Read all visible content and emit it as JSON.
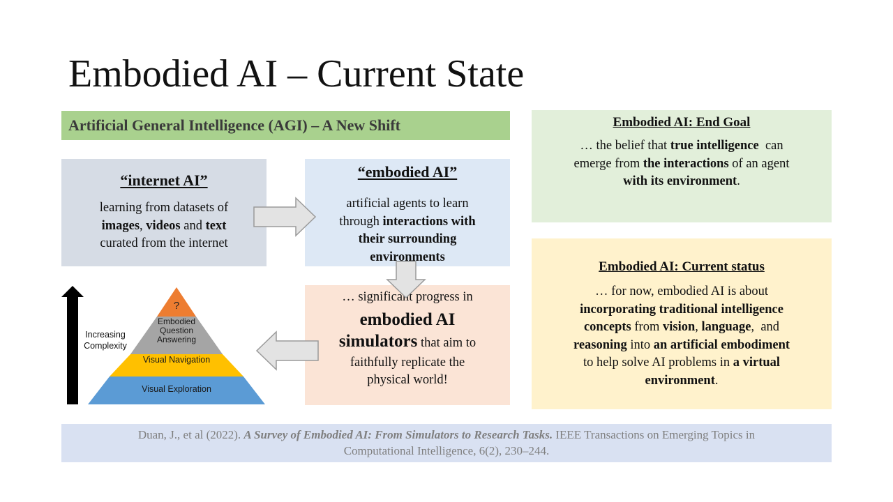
{
  "title": "Embodied AI – Current State",
  "agi_banner": "Artificial General Intelligence (AGI) – A New Shift",
  "internet_ai": {
    "heading": "“internet AI”",
    "line1": "learning from datasets of",
    "images": "images",
    "comma": ",",
    "videos": "videos",
    "and": " and ",
    "text": "text",
    "line3": "curated from the internet"
  },
  "embodied_ai": {
    "heading": "“embodied AI”",
    "line1": "artificial agents to learn",
    "through": "through ",
    "bold1": "interactions with",
    "bold2": "their surrounding",
    "bold3": "environments"
  },
  "simulators": {
    "line1": "… significant progress in",
    "big1": "embodied AI",
    "big2": "simulators",
    "rest2": " that aim to",
    "line3": "faithfully replicate the",
    "line4": "physical world!"
  },
  "end_goal": {
    "heading": "Embodied AI: End Goal",
    "p1": "… the belief that ",
    "b1": "true intelligence",
    "p2": "  can",
    "p3": "emerge from ",
    "b2": "the interactions",
    "p4": " of an agent",
    "b3": "with its environment",
    "p5": "."
  },
  "current_status": {
    "heading": "Embodied AI: Current status",
    "l1": "… for now, embodied AI is about",
    "b1": "incorporating traditional intelligence",
    "b2": "concepts",
    "p2": " from ",
    "b3": "vision",
    "p3": ", ",
    "b4": "language",
    "p4": ",  and",
    "b5": "reasoning",
    "p5": " into ",
    "b6": "an artificial embodiment",
    "p6": "to help solve AI problems in ",
    "b7": "a virtual",
    "b8": "environment",
    "p7": "."
  },
  "pyramid": {
    "axis_label_1": "Increasing",
    "axis_label_2": "Complexity",
    "top": "?",
    "level2_1": "Embodied",
    "level2_2": "Question",
    "level2_3": "Answering",
    "level3": "Visual Navigation",
    "level4": "Visual Exploration"
  },
  "citation": {
    "authors": "Duan, J., et al (2022).",
    "paper_title": "A Survey of Embodied AI: From Simulators to Research Tasks.",
    "journal1": " IEEE Transactions on Emerging Topics in",
    "journal2": "Computational Intelligence, 6(2), 230–244."
  },
  "colors": {
    "agi_banner": "#a9d18e",
    "internet_box": "#d6dce5",
    "embodied_box": "#dde8f5",
    "simulators_box": "#fbe4d6",
    "end_goal_box": "#e2efda",
    "status_box": "#fff2cc",
    "citation_box": "#d9e1f2",
    "pyramid_top": "#ed7d31",
    "pyramid_level2": "#a5a5a5",
    "pyramid_level3": "#ffc000",
    "pyramid_level4": "#5b9bd5"
  }
}
